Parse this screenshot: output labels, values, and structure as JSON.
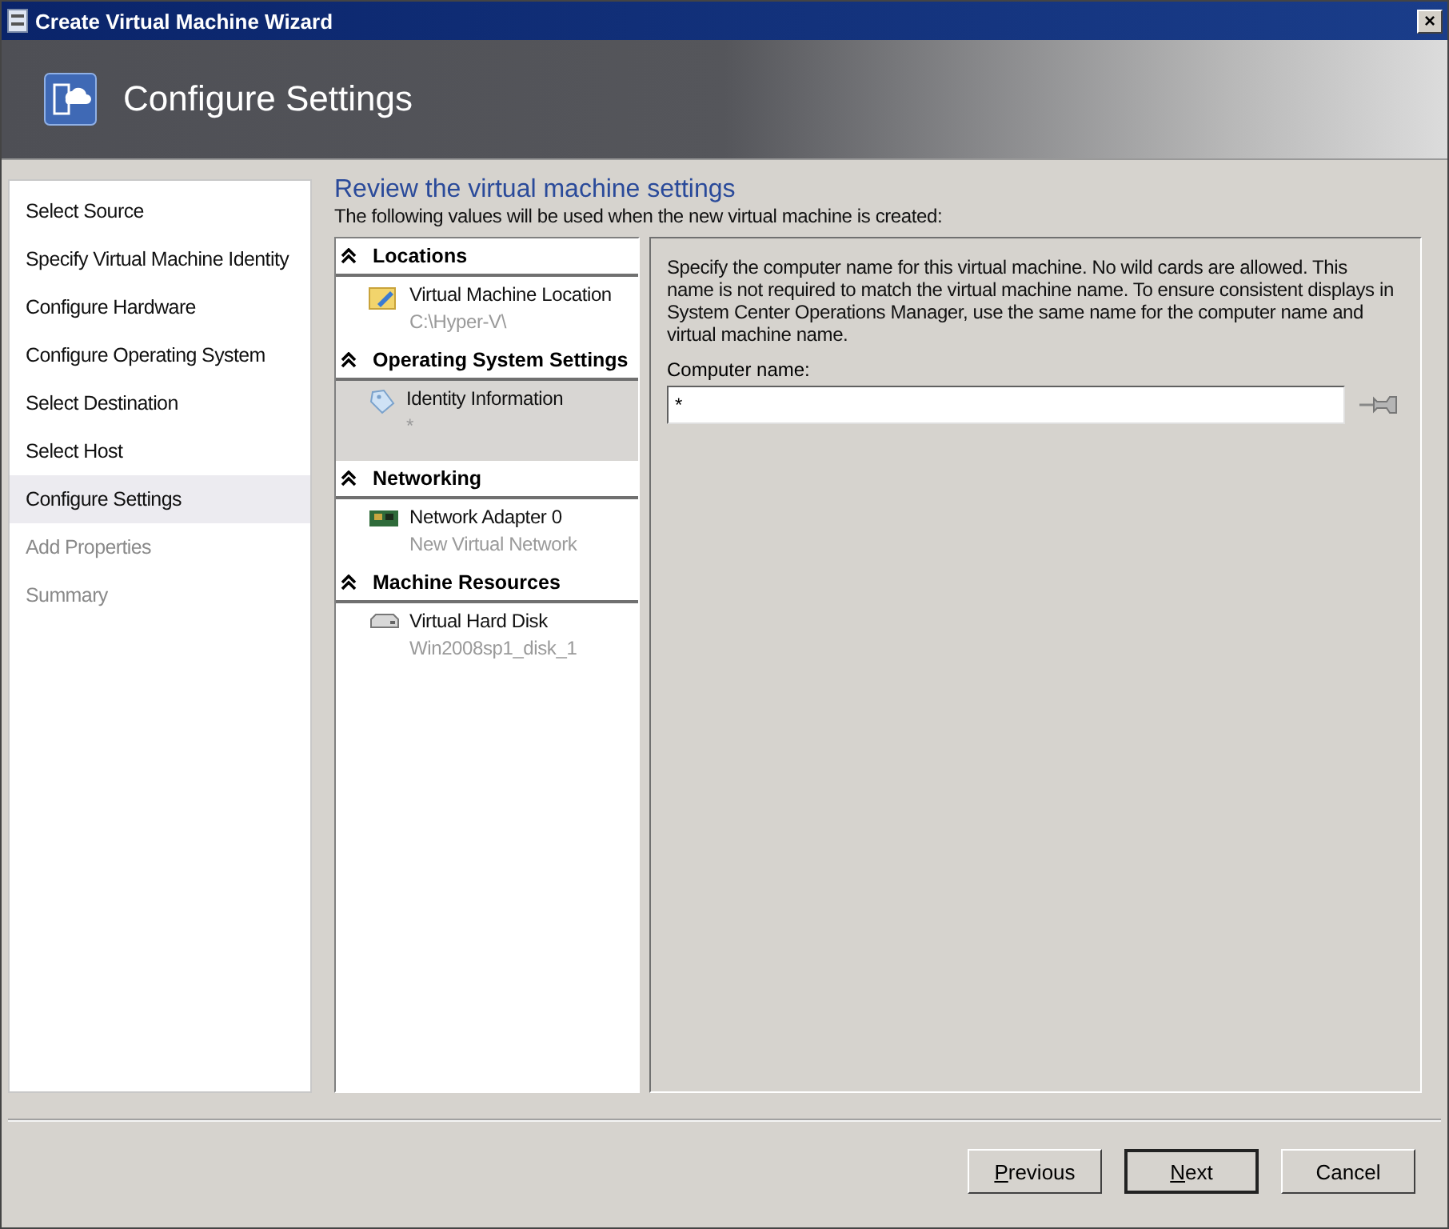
{
  "window": {
    "title": "Create Virtual Machine Wizard",
    "close": "×"
  },
  "header": {
    "title": "Configure Settings"
  },
  "steps": [
    {
      "label": "Select Source",
      "selected": false,
      "disabled": false
    },
    {
      "label": "Specify Virtual Machine Identity",
      "selected": false,
      "disabled": false
    },
    {
      "label": "Configure Hardware",
      "selected": false,
      "disabled": false
    },
    {
      "label": "Configure Operating System",
      "selected": false,
      "disabled": false
    },
    {
      "label": "Select Destination",
      "selected": false,
      "disabled": false
    },
    {
      "label": "Select Host",
      "selected": false,
      "disabled": false
    },
    {
      "label": "Configure Settings",
      "selected": true,
      "disabled": false
    },
    {
      "label": "Add Properties",
      "selected": false,
      "disabled": true
    },
    {
      "label": "Summary",
      "selected": false,
      "disabled": true
    }
  ],
  "page": {
    "heading": "Review the virtual machine settings",
    "subtitle": "The following values will be used when the new virtual machine is created:"
  },
  "settings": [
    {
      "section": "Locations",
      "expanded": true,
      "items": [
        {
          "kind": "folder",
          "name": "Virtual Machine Location",
          "value": "C:\\Hyper-V\\",
          "selected": false
        }
      ]
    },
    {
      "section": "Operating System Settings",
      "expanded": true,
      "items": [
        {
          "kind": "tag",
          "name": "Identity Information",
          "value": "*",
          "selected": true
        }
      ]
    },
    {
      "section": "Networking",
      "expanded": true,
      "items": [
        {
          "kind": "network",
          "name": "Network Adapter 0",
          "value": "New Virtual Network",
          "selected": false
        }
      ]
    },
    {
      "section": "Machine Resources",
      "expanded": true,
      "items": [
        {
          "kind": "disk",
          "name": "Virtual Hard Disk",
          "value": "Win2008sp1_disk_1",
          "selected": false
        }
      ]
    }
  ],
  "detail": {
    "description": "Specify the computer name for this virtual machine. No wild cards are allowed. This name is not required to match the virtual machine name. To ensure consistent displays in System Center Operations Manager, use the same name for the computer name and virtual machine name.",
    "field_label": "Computer name:",
    "field_value": "*"
  },
  "buttons": [
    {
      "label": "Previous",
      "first_letter_underlined": true,
      "default": false
    },
    {
      "label": "Next",
      "first_letter_underlined": true,
      "default": true
    },
    {
      "label": "Cancel",
      "first_letter_underlined": false,
      "default": false
    }
  ]
}
